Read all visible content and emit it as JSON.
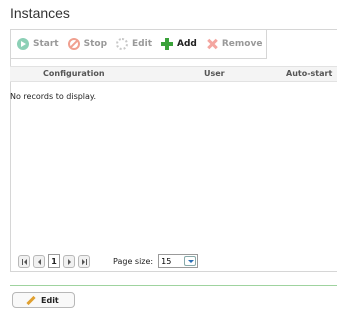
{
  "page": {
    "title": "Instances"
  },
  "toolbar": {
    "start": "Start",
    "stop": "Stop",
    "edit": "Edit",
    "add": "Add",
    "remove": "Remove"
  },
  "grid": {
    "columns": [
      "Configuration",
      "User",
      "Auto-start"
    ],
    "empty_message": "No records to display."
  },
  "pager": {
    "current_page": "1",
    "page_size_label": "Page size:",
    "page_size_value": "15"
  },
  "footer": {
    "edit": "Edit"
  },
  "colors": {
    "separator": "#9fd39f",
    "add_green": "#3aa23a",
    "start_green": "#8cd0b6",
    "stop_red": "#f0a090"
  }
}
